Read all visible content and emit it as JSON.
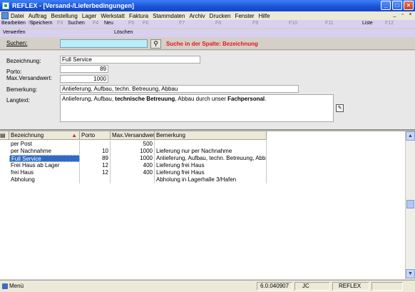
{
  "window": {
    "title": "REFLEX - [Versand-/Lieferbedingungen]"
  },
  "menu": [
    "Datei",
    "Auftrag",
    "Bestellung",
    "Lager",
    "Werkstatt",
    "Faktura",
    "Stammdaten",
    "Archiv",
    "Drucken",
    "Fenster",
    "Hilfe"
  ],
  "fkeys_row1": [
    {
      "num": "F2",
      "label": "Bearbeiten"
    },
    {
      "num": "F3",
      "label": "Speichern"
    },
    {
      "num": "F4",
      "label": "Suchen"
    },
    {
      "num": "F5",
      "label": "Neu"
    },
    {
      "num": "F6",
      "label": ""
    },
    {
      "num": "F7",
      "label": ""
    },
    {
      "num": "F8",
      "label": ""
    },
    {
      "num": "F9",
      "label": ""
    },
    {
      "num": "F10",
      "label": ""
    },
    {
      "num": "F11",
      "label": ""
    },
    {
      "num": "F12",
      "label": "Liste"
    }
  ],
  "fkeys_row2": [
    "Verwerfen",
    "Löschen"
  ],
  "search": {
    "label": "Suchen:",
    "value": "",
    "hint": "Suche in der Spalte: Bezeichnung"
  },
  "form": {
    "bezeichnung_label": "Bezeichnung:",
    "bezeichnung": "Full Service",
    "porto_label": "Porto:",
    "porto": "89",
    "versandwert_label": "Max.Versandwert:",
    "versandwert": "1000",
    "bemerkung_label": "Bemerkung:",
    "bemerkung": "Anlieferung, Aufbau, techn. Betreuung, Abbau",
    "langtext_label": "Langtext:",
    "langtext_parts": [
      "Anlieferung, Aufbau, ",
      "technische Betreuung",
      ", Abbau durch unser ",
      "Fachpersonal",
      "."
    ]
  },
  "table": {
    "columns": [
      "Bezeichnung",
      "Porto",
      "Max.Versandwert",
      "Bemerkung"
    ],
    "rows": [
      {
        "bezeichnung": "per Post",
        "porto": "",
        "versandwert": "500",
        "bemerkung": ""
      },
      {
        "bezeichnung": "per Nachnahme",
        "porto": "10",
        "versandwert": "1000",
        "bemerkung": "Lieferung nur per Nachnahme"
      },
      {
        "bezeichnung": "Full Service",
        "porto": "89",
        "versandwert": "1000",
        "bemerkung": "Anlieferung, Aufbau, techn. Betreuung, Abbau",
        "selected": true
      },
      {
        "bezeichnung": "Frei Haus ab Lager",
        "porto": "12",
        "versandwert": "400",
        "bemerkung": "Lieferung frei Haus"
      },
      {
        "bezeichnung": "frei Haus",
        "porto": "12",
        "versandwert": "400",
        "bemerkung": "Lieferung frei Haus"
      },
      {
        "bezeichnung": "Abholung",
        "porto": "",
        "versandwert": "",
        "bemerkung": "Abholung in Lagerhalle 3/Hafen"
      }
    ]
  },
  "status": {
    "menu": "Menü",
    "version": "6.0.040907",
    "user": "JC",
    "app": "REFLEX"
  }
}
